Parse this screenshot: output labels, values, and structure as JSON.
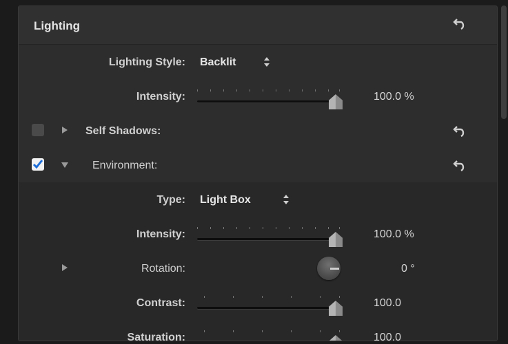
{
  "header": {
    "title": "Lighting"
  },
  "lighting_style": {
    "label": "Lighting Style:",
    "value": "Backlit"
  },
  "intensity": {
    "label": "Intensity:",
    "value": "100.0 %",
    "level": 1.0
  },
  "self_shadows": {
    "label": "Self Shadows:",
    "checked": false,
    "expanded": false
  },
  "environment": {
    "label": "Environment:",
    "checked": true,
    "expanded": true
  },
  "env_type": {
    "label": "Type:",
    "value": "Light Box"
  },
  "env_intensity": {
    "label": "Intensity:",
    "value": "100.0 %",
    "level": 1.0
  },
  "env_rotation": {
    "label": "Rotation:",
    "value": "0 °"
  },
  "env_contrast": {
    "label": "Contrast:",
    "value": "100.0",
    "level": 1.0
  },
  "env_saturation": {
    "label": "Saturation:",
    "value": "100.0",
    "level": 1.0
  },
  "icons": {
    "revert": "revert-arrow-icon",
    "stepper": "up-down-stepper-icon",
    "checkmark": "checkmark-icon",
    "disclosure": "disclosure-triangle-icon"
  }
}
